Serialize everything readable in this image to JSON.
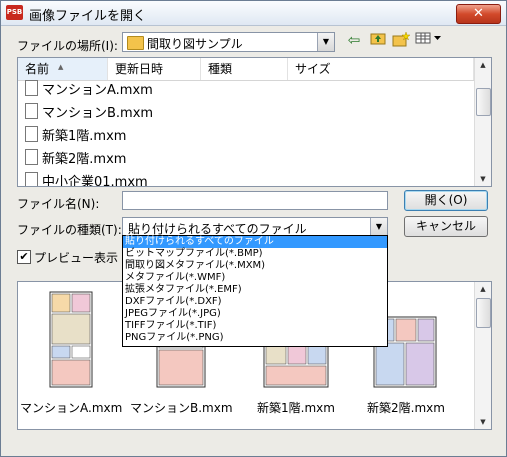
{
  "window": {
    "title": "画像ファイルを開く",
    "icon_text": "PSB",
    "close_glyph": "✕"
  },
  "location": {
    "label": "ファイルの場所(I):",
    "value": "間取り図サンプル",
    "tools": [
      "back-icon",
      "up-folder-icon",
      "new-folder-icon",
      "view-menu-icon"
    ]
  },
  "list": {
    "columns": [
      "名前",
      "更新日時",
      "種類",
      "サイズ"
    ],
    "sorted_column": "名前",
    "files": [
      "マンションA.mxm",
      "マンションB.mxm",
      "新築1階.mxm",
      "新築2階.mxm",
      "中小企業01.mxm"
    ]
  },
  "filename": {
    "label": "ファイル名(N):",
    "value": ""
  },
  "filetype": {
    "label": "ファイルの種類(T):",
    "value": "貼り付けられるすべてのファイル",
    "options": [
      "貼り付けられるすべてのファイル",
      "ビットマップファイル(*.BMP)",
      "間取り図メタファイル(*.MXM)",
      "メタファイル(*.WMF)",
      "拡張メタファイル(*.EMF)",
      "DXFファイル(*.DXF)",
      "JPEGファイル(*.JPG)",
      "TIFFファイル(*.TIF)",
      "PNGファイル(*.PNG)"
    ],
    "selected_index": 0
  },
  "buttons": {
    "open": "開く(O)",
    "cancel": "キャンセル"
  },
  "preview": {
    "checkbox_label": "プレビュー表示",
    "checked": true,
    "check_glyph": "✔",
    "items": [
      "マンションA.mxm",
      "マンションB.mxm",
      "新築1階.mxm",
      "新築2階.mxm"
    ]
  }
}
